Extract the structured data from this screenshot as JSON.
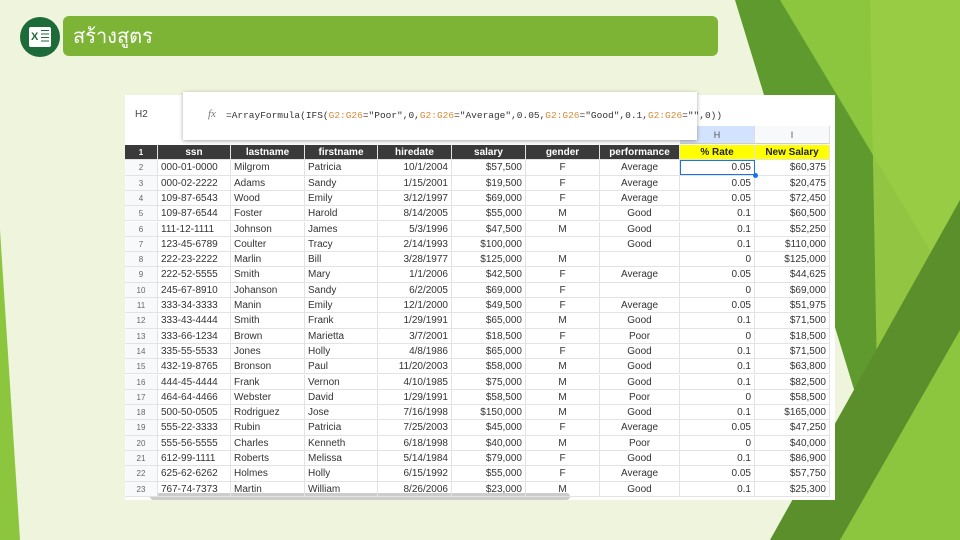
{
  "title": "สร้างสูตร",
  "logo_letter": "X",
  "sheet": {
    "name_box": "H2",
    "formula_parts": [
      {
        "t": "=ArrayFormula(IFS(",
        "ref": false
      },
      {
        "t": "G2:G26",
        "ref": true
      },
      {
        "t": "=\"Poor\",0,",
        "ref": false
      },
      {
        "t": "G2:G26",
        "ref": true
      },
      {
        "t": "=\"Average\",0.05,",
        "ref": false
      },
      {
        "t": "G2:G26",
        "ref": true
      },
      {
        "t": "=\"Good\",0.1,",
        "ref": false
      },
      {
        "t": "G2:G26",
        "ref": true
      },
      {
        "t": "=\"\",0))",
        "ref": false
      }
    ],
    "column_letters": [
      "H",
      "I"
    ],
    "headers": [
      "ssn",
      "lastname",
      "firstname",
      "hiredate",
      "salary",
      "gender",
      "performance",
      "% Rate",
      "New Salary"
    ],
    "rows": [
      [
        "000-01-0000",
        "Milgrom",
        "Patricia",
        "10/1/2004",
        "$57,500",
        "F",
        "Average",
        "0.05",
        "$60,375"
      ],
      [
        "000-02-2222",
        "Adams",
        "Sandy",
        "1/15/2001",
        "$19,500",
        "F",
        "Average",
        "0.05",
        "$20,475"
      ],
      [
        "109-87-6543",
        "Wood",
        "Emily",
        "3/12/1997",
        "$69,000",
        "F",
        "Average",
        "0.05",
        "$72,450"
      ],
      [
        "109-87-6544",
        "Foster",
        "Harold",
        "8/14/2005",
        "$55,000",
        "M",
        "Good",
        "0.1",
        "$60,500"
      ],
      [
        "111-12-1111",
        "Johnson",
        "James",
        "5/3/1996",
        "$47,500",
        "M",
        "Good",
        "0.1",
        "$52,250"
      ],
      [
        "123-45-6789",
        "Coulter",
        "Tracy",
        "2/14/1993",
        "$100,000",
        "",
        "Good",
        "0.1",
        "$110,000"
      ],
      [
        "222-23-2222",
        "Marlin",
        "Bill",
        "3/28/1977",
        "$125,000",
        "M",
        "",
        "0",
        "$125,000"
      ],
      [
        "222-52-5555",
        "Smith",
        "Mary",
        "1/1/2006",
        "$42,500",
        "F",
        "Average",
        "0.05",
        "$44,625"
      ],
      [
        "245-67-8910",
        "Johanson",
        "Sandy",
        "6/2/2005",
        "$69,000",
        "F",
        "",
        "0",
        "$69,000"
      ],
      [
        "333-34-3333",
        "Manin",
        "Emily",
        "12/1/2000",
        "$49,500",
        "F",
        "Average",
        "0.05",
        "$51,975"
      ],
      [
        "333-43-4444",
        "Smith",
        "Frank",
        "1/29/1991",
        "$65,000",
        "M",
        "Good",
        "0.1",
        "$71,500"
      ],
      [
        "333-66-1234",
        "Brown",
        "Marietta",
        "3/7/2001",
        "$18,500",
        "F",
        "Poor",
        "0",
        "$18,500"
      ],
      [
        "335-55-5533",
        "Jones",
        "Holly",
        "4/8/1986",
        "$65,000",
        "F",
        "Good",
        "0.1",
        "$71,500"
      ],
      [
        "432-19-8765",
        "Bronson",
        "Paul",
        "11/20/2003",
        "$58,000",
        "M",
        "Good",
        "0.1",
        "$63,800"
      ],
      [
        "444-45-4444",
        "Frank",
        "Vernon",
        "4/10/1985",
        "$75,000",
        "M",
        "Good",
        "0.1",
        "$82,500"
      ],
      [
        "464-64-4466",
        "Webster",
        "David",
        "1/29/1991",
        "$58,500",
        "M",
        "Poor",
        "0",
        "$58,500"
      ],
      [
        "500-50-0505",
        "Rodriguez",
        "Jose",
        "7/16/1998",
        "$150,000",
        "M",
        "Good",
        "0.1",
        "$165,000"
      ],
      [
        "555-22-3333",
        "Rubin",
        "Patricia",
        "7/25/2003",
        "$45,000",
        "F",
        "Average",
        "0.05",
        "$47,250"
      ],
      [
        "555-56-5555",
        "Charles",
        "Kenneth",
        "6/18/1998",
        "$40,000",
        "M",
        "Poor",
        "0",
        "$40,000"
      ],
      [
        "612-99-1111",
        "Roberts",
        "Melissa",
        "5/14/1984",
        "$79,000",
        "F",
        "Good",
        "0.1",
        "$86,900"
      ],
      [
        "625-62-6262",
        "Holmes",
        "Holly",
        "6/15/1992",
        "$55,000",
        "F",
        "Average",
        "0.05",
        "$57,750"
      ],
      [
        "767-74-7373",
        "Martin",
        "William",
        "8/26/2006",
        "$23,000",
        "M",
        "Good",
        "0.1",
        "$25,300"
      ]
    ]
  }
}
